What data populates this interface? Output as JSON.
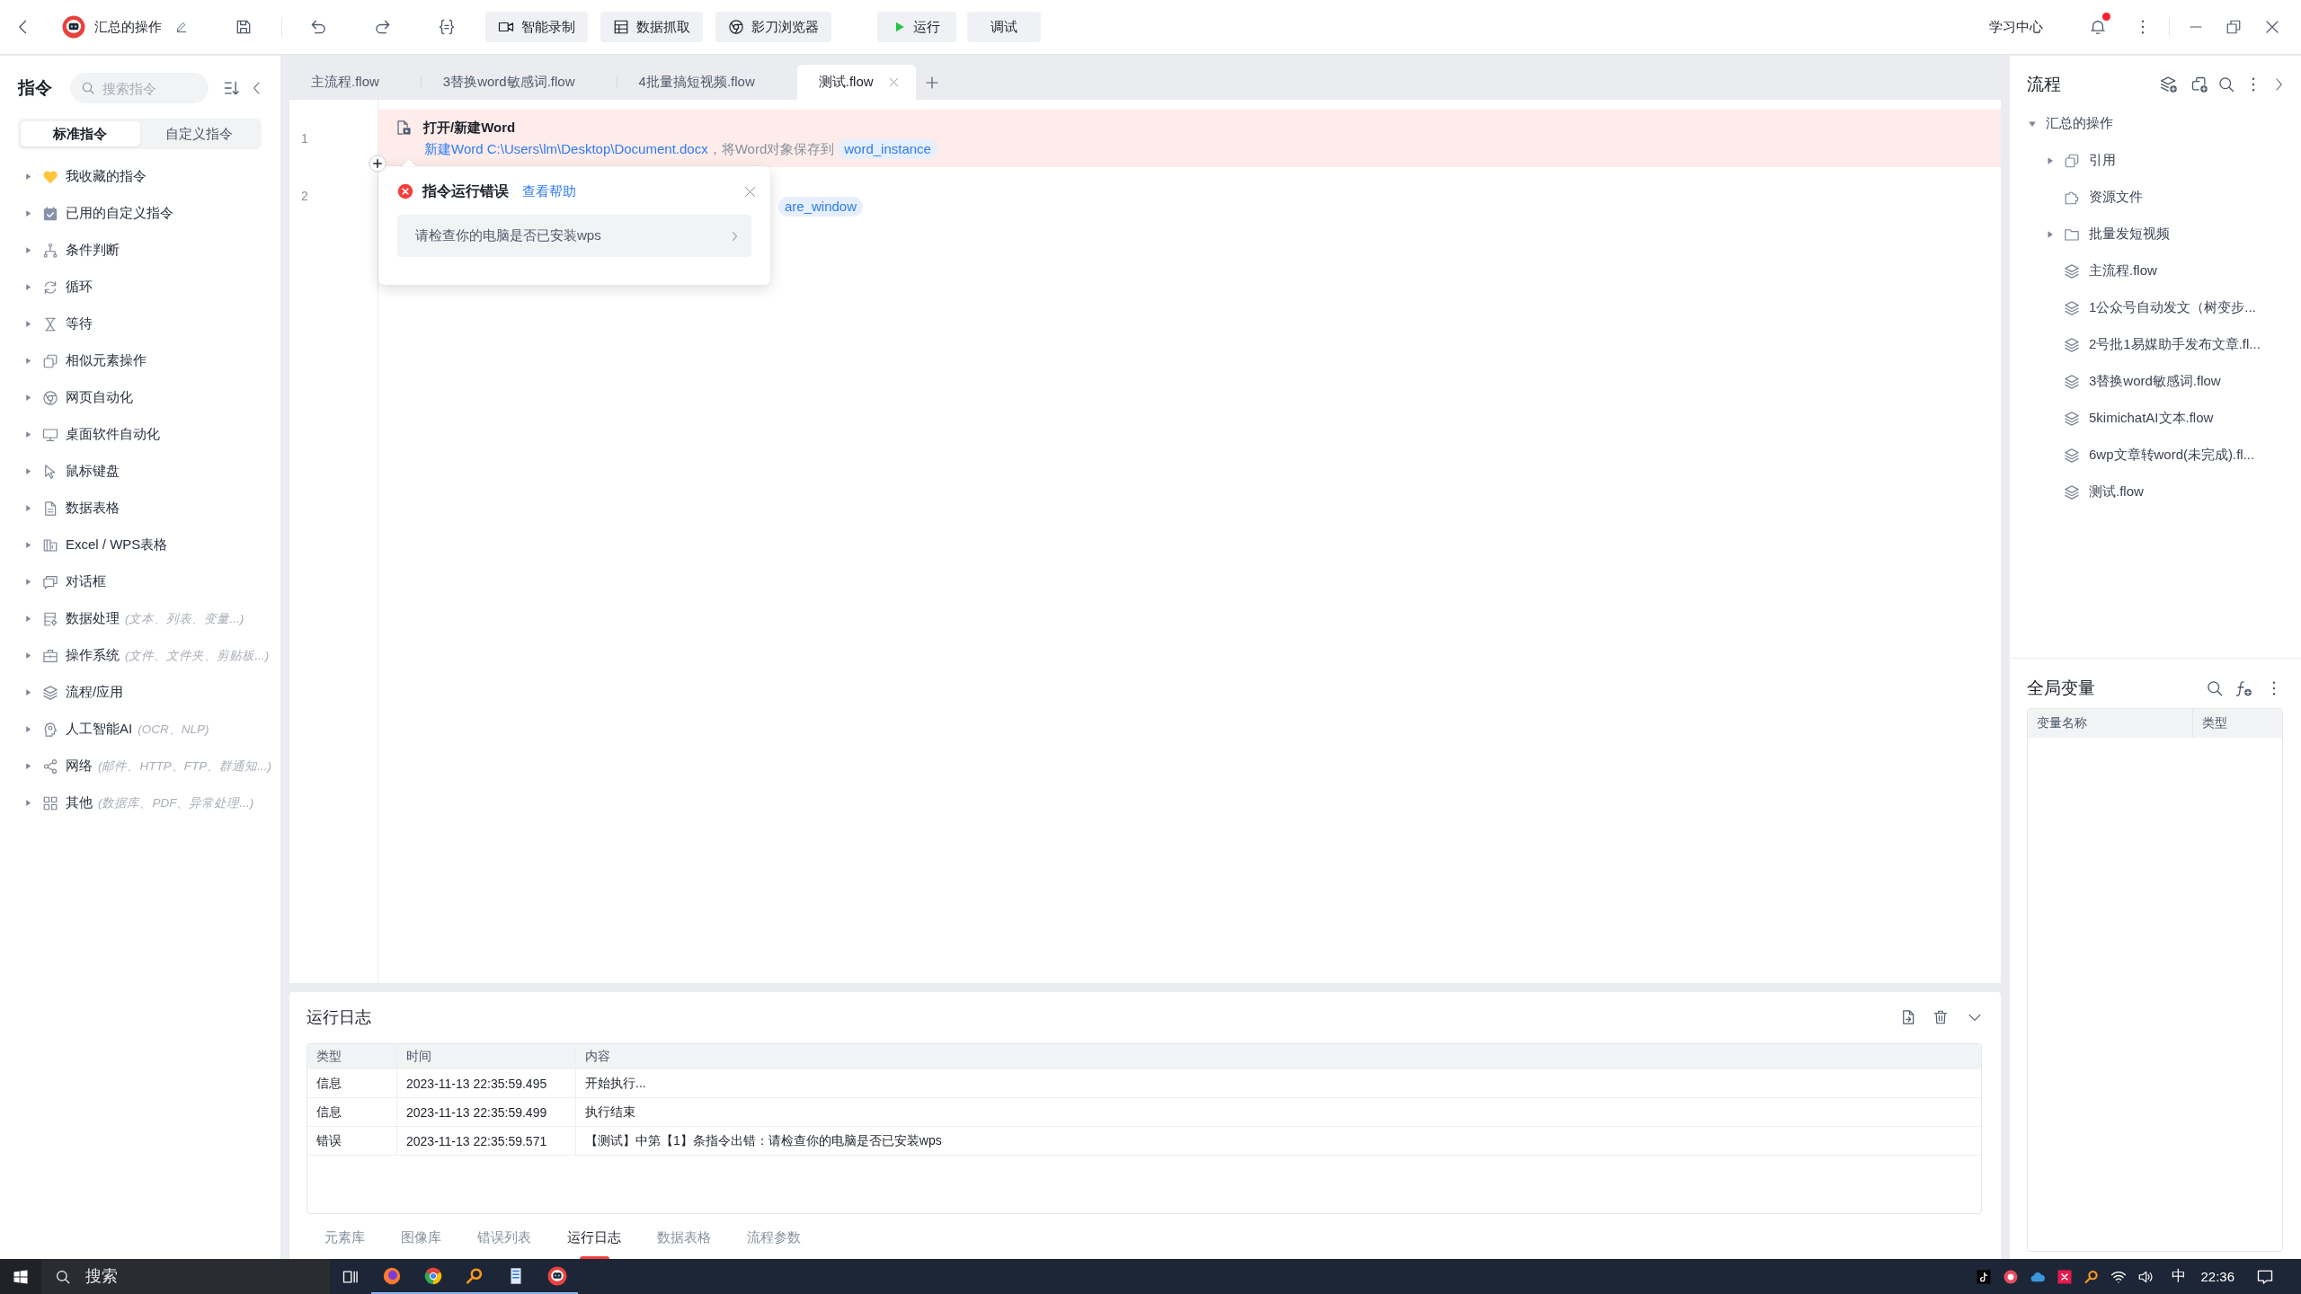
{
  "title_bar": {
    "project_name": "汇总的操作",
    "tools": [
      {
        "kind": "record",
        "label": "智能录制"
      },
      {
        "kind": "capture",
        "label": "数据抓取"
      },
      {
        "kind": "browser",
        "label": "影刀浏览器"
      }
    ],
    "run_button": "运行",
    "debug_button": "调试",
    "learning_center": "学习中心",
    "notifications_unread": true
  },
  "commands_panel": {
    "title": "指令",
    "search": {
      "placeholder": "搜索指令"
    },
    "segments": [
      {
        "label": "标准指令",
        "selected": true
      },
      {
        "label": "自定义指令",
        "selected": false
      }
    ],
    "items": [
      {
        "label": "我收藏的指令",
        "expanded": false
      },
      {
        "label": "已用的自定义指令",
        "expanded": false
      },
      {
        "label": "条件判断",
        "expanded": false
      },
      {
        "label": "循环",
        "expanded": false
      },
      {
        "label": "等待",
        "expanded": false
      },
      {
        "label": "相似元素操作",
        "expanded": false
      },
      {
        "label": "网页自动化",
        "expanded": false
      },
      {
        "label": "桌面软件自动化",
        "expanded": false
      },
      {
        "label": "鼠标键盘",
        "expanded": false
      },
      {
        "label": "数据表格",
        "expanded": false
      },
      {
        "label": "Excel / WPS表格",
        "expanded": false
      },
      {
        "label": "对话框",
        "expanded": false
      },
      {
        "label": "数据处理",
        "hint": "(文本、列表、变量...)",
        "expanded": false
      },
      {
        "label": "操作系统",
        "hint": "(文件、文件夹、剪贴板...)",
        "expanded": false
      },
      {
        "label": "流程/应用",
        "expanded": false
      },
      {
        "label": "人工智能AI",
        "hint": "(OCR、NLP)",
        "expanded": false
      },
      {
        "label": "网络",
        "hint": "(邮件、HTTP、FTP、群通知...)",
        "expanded": false
      },
      {
        "label": "其他",
        "hint": "(数据库、PDF、异常处理...)",
        "expanded": false
      }
    ]
  },
  "editor": {
    "tabs": [
      {
        "label": "主流程.flow",
        "selected": false
      },
      {
        "label": "3替换word敏感词.flow",
        "selected": false
      },
      {
        "label": "4批量搞短视频.flow",
        "selected": false
      },
      {
        "label": "测试.flow",
        "selected": true
      }
    ],
    "steps": [
      {
        "number": "1",
        "error": true,
        "title": "打开/新建Word",
        "description": [
          {
            "kind": "value",
            "text": "新建Word C:\\Users\\lm\\Desktop\\Document.docx"
          },
          {
            "kind": "plain",
            "text": "，将Word对象保存到"
          },
          {
            "kind": "variable",
            "text": "word_instance"
          }
        ]
      },
      {
        "number": "2",
        "error": false,
        "description": [
          {
            "kind": "variable",
            "text": "are_window"
          }
        ]
      }
    ],
    "error_popup": {
      "title": "指令运行错误",
      "help_link": "查看帮助",
      "message": "请检查你的电脑是否已安装wps"
    }
  },
  "run_log": {
    "title": "运行日志",
    "columns": [
      "类型",
      "时间",
      "内容"
    ],
    "rows": [
      {
        "type": "信息",
        "time": "2023-11-13 22:35:59.495",
        "content": "开始执行..."
      },
      {
        "type": "信息",
        "time": "2023-11-13 22:35:59.499",
        "content": "执行结束"
      },
      {
        "type": "错误",
        "time": "2023-11-13 22:35:59.571",
        "content": "【测试】中第【1】条指令出错：请检查你的电脑是否已安装wps"
      }
    ],
    "tabs": [
      {
        "label": "元素库",
        "selected": false,
        "alert": false
      },
      {
        "label": "图像库",
        "selected": false,
        "alert": false
      },
      {
        "label": "错误列表",
        "selected": false,
        "alert": false
      },
      {
        "label": "运行日志",
        "selected": true,
        "alert": true
      },
      {
        "label": "数据表格",
        "selected": false,
        "alert": false
      },
      {
        "label": "流程参数",
        "selected": false,
        "alert": false
      }
    ]
  },
  "flow_panel": {
    "title": "流程",
    "tree": [
      {
        "label": "汇总的操作",
        "expanded": true,
        "children": [
          {
            "label": "引用",
            "kind": "reference",
            "expanded": false
          },
          {
            "label": "资源文件",
            "kind": "resources"
          },
          {
            "label": "批量发短视频",
            "kind": "folder",
            "expanded": false
          },
          {
            "label": "主流程.flow",
            "kind": "flow"
          },
          {
            "label": "1公众号自动发文（树变步...",
            "kind": "flow"
          },
          {
            "label": "2号批1易媒助手发布文章.fl...",
            "kind": "flow"
          },
          {
            "label": "3替换word敏感词.flow",
            "kind": "flow"
          },
          {
            "label": "5kimichatAI文本.flow",
            "kind": "flow"
          },
          {
            "label": "6wp文章转word(未完成).fl...",
            "kind": "flow"
          },
          {
            "label": "测试.flow",
            "kind": "flow"
          }
        ]
      }
    ]
  },
  "global_variables": {
    "title": "全局变量",
    "columns": [
      "变量名称",
      "类型"
    ]
  },
  "taskbar": {
    "search_placeholder": "搜索",
    "input_method": "中",
    "time": "22:36"
  }
}
